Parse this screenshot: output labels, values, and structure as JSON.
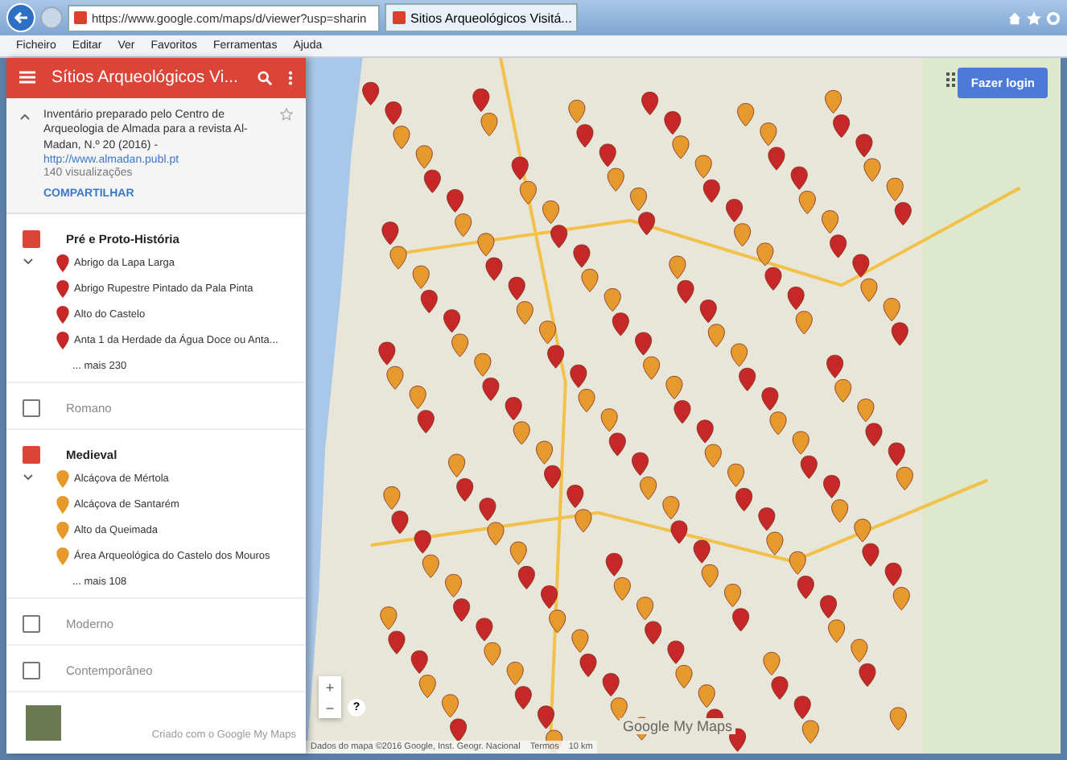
{
  "browser": {
    "address": "https://www.google.com/maps/d/viewer?usp=sharin",
    "tab_title": "Sitios Arqueológicos Visitá...",
    "menu": [
      "Ficheiro",
      "Editar",
      "Ver",
      "Favoritos",
      "Ferramentas",
      "Ajuda"
    ]
  },
  "sidebar": {
    "title": "Sítios Arqueológicos Vi...",
    "description": "Inventário preparado pelo Centro de Arqueologia de Almada para a revista Al-Madan, N.º 20 (2016) -",
    "link": "http://www.almadan.publ.pt",
    "views": "140 visualizações",
    "share": "COMPARTILHAR",
    "starred": false,
    "layers": [
      {
        "name": "Pré e Proto-História",
        "checked": true,
        "expanded": true,
        "color": "#c62828",
        "items": [
          "Abrigo da Lapa Larga",
          "Abrigo Rupestre Pintado da Pala Pinta",
          "Alto do Castelo",
          "Anta 1 da Herdade da Água Doce ou Anta..."
        ],
        "more": "... mais 230"
      },
      {
        "name": "Romano",
        "checked": false,
        "expanded": false
      },
      {
        "name": "Medieval",
        "checked": true,
        "expanded": true,
        "color": "#e69a2e",
        "items": [
          "Alcáçova de Mértola",
          "Alcáçova de Santarém",
          "Alto da Queimada",
          "Área Arqueológica do Castelo dos Mouros"
        ],
        "more": "... mais 108"
      },
      {
        "name": "Moderno",
        "checked": false,
        "expanded": false
      },
      {
        "name": "Contemporâneo",
        "checked": false,
        "expanded": false
      }
    ],
    "footer": "Criado com o Google My Maps"
  },
  "map": {
    "login": "Fazer login",
    "zoom_in": "+",
    "zoom_out": "−",
    "help": "?",
    "attribution": "Dados do mapa ©2016 Google, Inst. Geogr. Nacional",
    "terms": "Termos",
    "scale": "10 km",
    "logo": "Google My Maps"
  }
}
